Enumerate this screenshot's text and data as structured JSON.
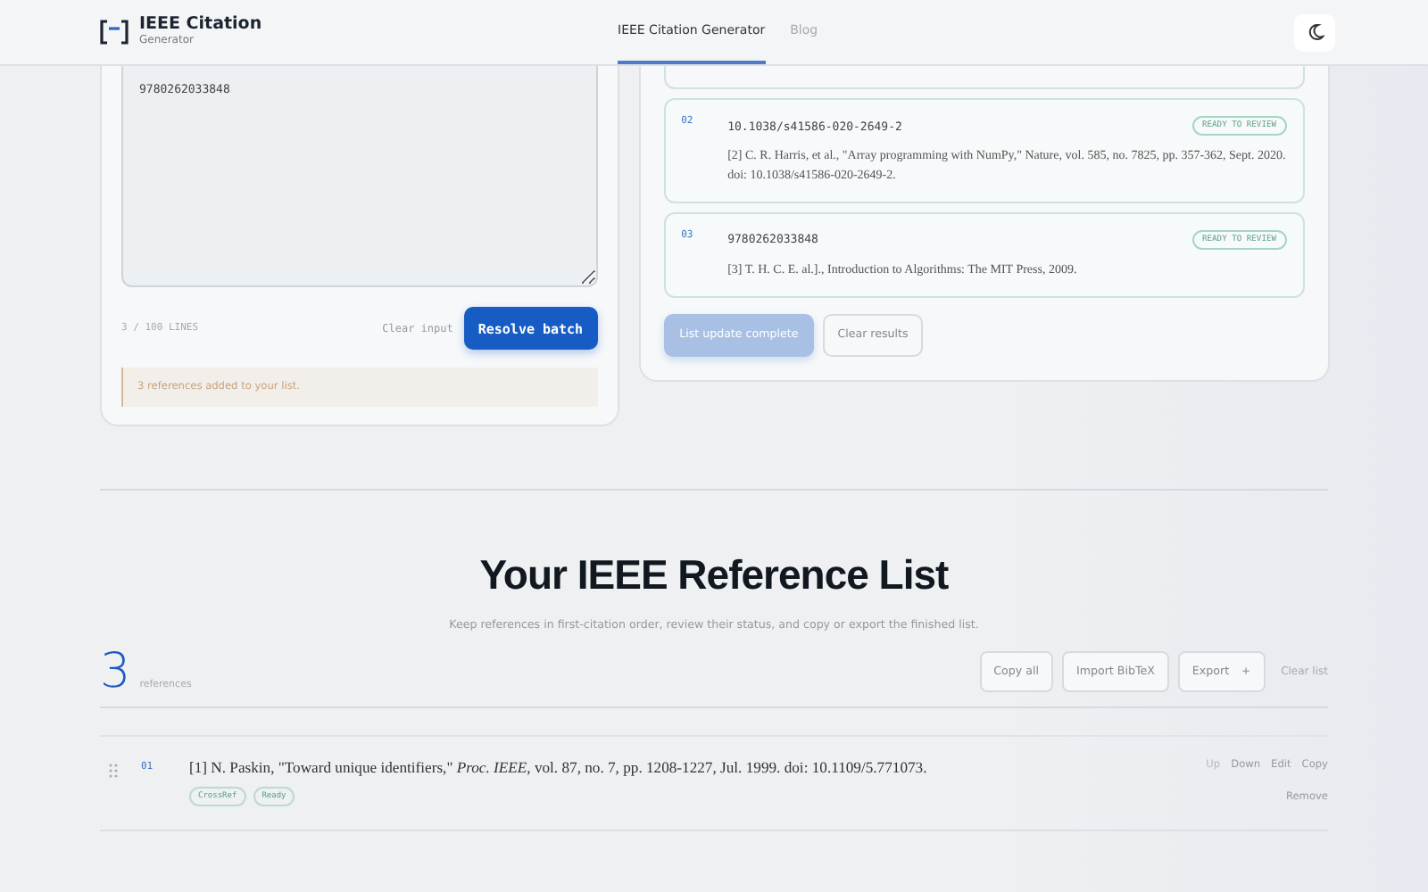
{
  "header": {
    "logo_title": "IEEE Citation",
    "logo_subtitle": "Generator",
    "nav": [
      {
        "label": "IEEE Citation Generator",
        "selected": true
      },
      {
        "label": "Blog",
        "selected": false
      }
    ]
  },
  "batch": {
    "input_value": "9780262033848",
    "line_count": "3 / 100 LINES",
    "clear_label": "Clear input",
    "resolve_label": "Resolve batch",
    "notice": "3 references added to your list."
  },
  "results": {
    "items": [
      {
        "number": "02",
        "identifier": "10.1038/s41586-020-2649-2",
        "status": "READY TO REVIEW",
        "citation": "[2] C. R. Harris, et al., \"Array programming with NumPy,\" Nature, vol. 585, no. 7825, pp. 357-362, Sept. 2020. doi: 10.1038/s41586-020-2649-2."
      },
      {
        "number": "03",
        "identifier": "9780262033848",
        "status": "READY TO REVIEW",
        "citation": "[3] T. H. C. E. al.]., Introduction to Algorithms: The MIT Press, 2009."
      }
    ],
    "primary": {
      "label": "List update complete",
      "disabled": true
    },
    "secondary": "Clear results"
  },
  "list": {
    "title": "Your IEEE Reference List",
    "subtitle": "Keep references in first-citation order, review their status, and copy or export the finished list.",
    "count": "3",
    "count_label": "references",
    "buttons": [
      "Copy all",
      "Import BibTeX",
      "Export"
    ],
    "export_caret": "+",
    "clear": "Clear list",
    "rows": [
      {
        "number": "01",
        "citation": "[1] N. Paskin, \"Toward unique identifiers,\" *Proc. IEEE*, vol. 87, no. 7, pp. 1208-1227, Jul. 1999. doi: 10.1109/5.771073.",
        "tags": [
          "CrossRef",
          "Ready"
        ],
        "actions": [
          {
            "label": "Up",
            "disabled": true
          },
          {
            "label": "Down",
            "disabled": false
          },
          {
            "label": "Edit",
            "disabled": false
          },
          {
            "label": "Copy",
            "disabled": false
          }
        ],
        "remove": "Remove"
      }
    ]
  }
}
